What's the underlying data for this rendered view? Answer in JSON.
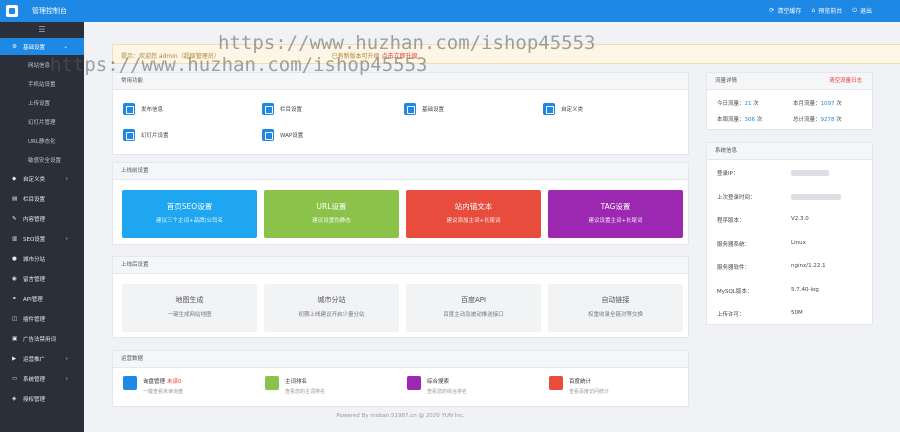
{
  "app": {
    "title": "管理控制台"
  },
  "topbar": {
    "clear_cache": "清空缓存",
    "preview": "预览前台",
    "logout": "退出"
  },
  "sidebar": {
    "toggle": "☰",
    "basic": {
      "label": "基础设置",
      "chevron": "⌄"
    },
    "sub_items": [
      "网站信息",
      "手机站设置",
      "上传设置",
      "幻灯片管理",
      "URL静态化",
      "敏感安全设置"
    ],
    "items": [
      {
        "label": "自定义类",
        "chevron": "›"
      },
      {
        "label": "栏目设置",
        "chevron": ""
      },
      {
        "label": "内容管理",
        "chevron": ""
      },
      {
        "label": "SEO设置",
        "chevron": "›"
      },
      {
        "label": "城市分站",
        "chevron": ""
      },
      {
        "label": "留言管理",
        "chevron": ""
      },
      {
        "label": "API管理",
        "chevron": ""
      },
      {
        "label": "插件管理",
        "chevron": ""
      },
      {
        "label": "广告法禁用词",
        "chevron": ""
      },
      {
        "label": "运营推广",
        "chevron": "›"
      },
      {
        "label": "系统管理",
        "chevron": "›"
      },
      {
        "label": "授权管理",
        "chevron": ""
      }
    ]
  },
  "notice": {
    "prefix": "提示：",
    "user": "欢迎您 admin（超级管理员）",
    "text": "已有新版本可升级",
    "link": "点击立即升级"
  },
  "quick": {
    "title": "常用功能",
    "items": [
      "发布信息",
      "栏目设置",
      "基础设置",
      "自定义类",
      "幻灯片设置",
      "WAP设置"
    ]
  },
  "seo": {
    "title": "上线前设置",
    "cards": [
      {
        "title": "首页SEO设置",
        "desc": "建议三个主词+品牌/公司名",
        "color": "#1ea6f0"
      },
      {
        "title": "URL设置",
        "desc": "建议设置伪静态",
        "color": "#8bc34a"
      },
      {
        "title": "站内锚文本",
        "desc": "建议添加主词+长尾词",
        "color": "#e74c3c"
      },
      {
        "title": "TAG设置",
        "desc": "建议设置主词+长尾词",
        "color": "#9c27b0"
      }
    ]
  },
  "general": {
    "title": "上线后设置",
    "cards": [
      {
        "title": "地图生成",
        "desc": "一键生成网站地图"
      },
      {
        "title": "城市分站",
        "desc": "初期上线建议开启少量分站"
      },
      {
        "title": "百度API",
        "desc": "百度主动及被动推送接口"
      },
      {
        "title": "自动链接",
        "desc": "权重收录全链对等交换"
      }
    ]
  },
  "ops": {
    "title": "运营数据",
    "items": [
      {
        "title": "询盘管理",
        "badge": "未读0",
        "desc": "一键查看未读询盘",
        "color": "#1e88e5"
      },
      {
        "title": "主词排名",
        "badge": "",
        "desc": "查看您的主词排名",
        "color": "#8bc34a"
      },
      {
        "title": "综合搜索",
        "badge": "",
        "desc": "查看您的综合排名",
        "color": "#9c27b0"
      },
      {
        "title": "百度统计",
        "badge": "",
        "desc": "查看百度访问统计",
        "color": "#e74c3c"
      }
    ]
  },
  "traffic": {
    "title": "流量详情",
    "clear": "清空流量日志",
    "today_label": "今日流量：",
    "today_value": "21",
    "month_label": "本月流量：",
    "month_value": "1097",
    "week_label": "本周流量：",
    "week_value": "306",
    "total_label": "总计流量：",
    "total_value": "9278",
    "unit": "次"
  },
  "system": {
    "title": "系统信息",
    "rows": [
      {
        "key": "登录IP：",
        "value": ""
      },
      {
        "key": "上次登录时间：",
        "value": ""
      },
      {
        "key": "程序版本：",
        "value": "V2.3.0"
      },
      {
        "key": "服务器系统：",
        "value": "Linux"
      },
      {
        "key": "服务器软件：",
        "value": "nginx/1.22.1"
      },
      {
        "key": "MySQL版本：",
        "value": "5.7.40-log"
      },
      {
        "key": "上传许可：",
        "value": "50M"
      }
    ]
  },
  "footer": "Powered By moban.51987.cn @ 2020 YUN Inc.",
  "watermark": "https://www.huzhan.com/ishop45553",
  "colors": {
    "brand": "#1e88e5",
    "sidebar": "#2b2f3a"
  }
}
